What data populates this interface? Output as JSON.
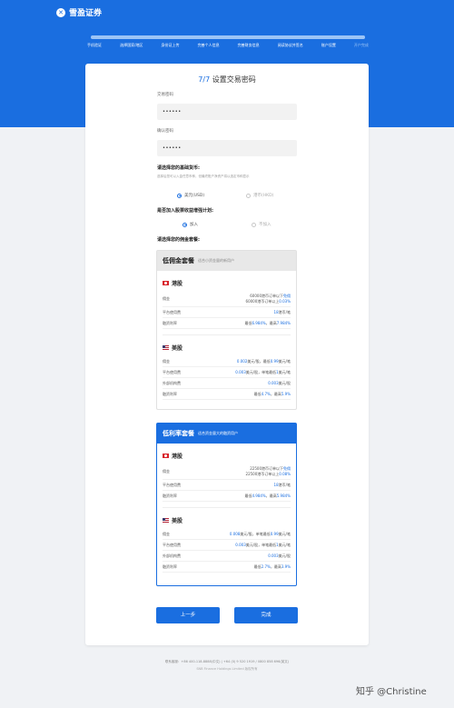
{
  "brand": {
    "logo_mark": "✕",
    "name": "雪盈证券"
  },
  "progress": {
    "fraction": 1.0
  },
  "steps": [
    "手机验证",
    "选择国家/地区",
    "身份证上传",
    "完善个人信息",
    "完善财务信息",
    "阅读协议并签名",
    "账户设置",
    "开户完成"
  ],
  "form": {
    "step_current": "7",
    "step_sep": "/",
    "step_total": "7",
    "title": "设置交易密码",
    "pwd_label": "交易密码",
    "pwd_value": "••••••",
    "confirm_label": "确认密码",
    "confirm_value": "••••••",
    "currency_q": "请选择您的基础货币:",
    "currency_hint": "选择后您可以入金任意币种，但最终账户净资产将以选定币种显示",
    "currency_opts": [
      "美元(USD)",
      "港币(HKD)"
    ],
    "margin_q": "是否加入股票收益增强计划:",
    "margin_opts": [
      "加入",
      "不加入"
    ],
    "pkg_q": "请选择您的佣金套餐:"
  },
  "packages": [
    {
      "name": "低佣金套餐",
      "sub": "适合小资金量的新用户",
      "markets": [
        {
          "name": "港股",
          "rows": [
            {
              "k": "佣金",
              "v1": "60000港币订单以下",
              "h1": "免佣",
              "v2": "60000港币订单以上",
              "h2": "0.03%"
            },
            {
              "k": "平台使用费",
              "h1": "18",
              "v1": "港币/笔"
            },
            {
              "k": "融资利率",
              "v1": "最低",
              "h1": "6.984%",
              "v2": "，最高",
              "h2": "7.984%"
            }
          ]
        },
        {
          "name": "美股",
          "rows": [
            {
              "k": "佣金",
              "h1": "0.002",
              "v1": "美元/股，最低",
              "h2": "0.99",
              "v2": "美元/笔"
            },
            {
              "k": "平台使用费",
              "h1": "0.003",
              "v1": "美元/股，单笔最低",
              "h2": "1",
              "v2": "美元/笔"
            },
            {
              "k": "外部机构费",
              "h1": "0.003",
              "v1": "美元/股"
            },
            {
              "k": "融资利率",
              "v1": "最低",
              "h1": "4.7%",
              "v2": "，最高",
              "h2": "5.9%"
            }
          ]
        }
      ]
    },
    {
      "name": "低利率套餐",
      "sub": "适合资金量大的融资用户",
      "markets": [
        {
          "name": "港股",
          "rows": [
            {
              "k": "佣金",
              "v1": "22500港币订单以下",
              "h1": "免佣",
              "v2": "22500港币订单以上",
              "h2": "0.08%"
            },
            {
              "k": "平台使用费",
              "h1": "18",
              "v1": "港币/笔"
            },
            {
              "k": "融资利率",
              "v1": "最低",
              "h1": "4.984%",
              "v2": "，最高",
              "h2": "5.984%"
            }
          ]
        },
        {
          "name": "美股",
          "rows": [
            {
              "k": "佣金",
              "h1": "0.008",
              "v1": "美元/股，单笔最低",
              "h2": "0.99",
              "v2": "美元/笔"
            },
            {
              "k": "平台使用费",
              "h1": "0.003",
              "v1": "美元/股，单笔最低",
              "h2": "1",
              "v2": "美元/笔"
            },
            {
              "k": "外部机构费",
              "h1": "0.003",
              "v1": "美元/股"
            },
            {
              "k": "融资利率",
              "v1": "最低",
              "h1": "2.7%",
              "v2": "，最高",
              "h2": "3.9%"
            }
          ]
        }
      ]
    }
  ],
  "buttons": {
    "prev": "上一步",
    "done": "完成"
  },
  "footer": {
    "line1": "联系客服：+86 400-118-8888(中文) | +64 (0) 9 520 1919 / 0800 858 696(英文)",
    "line2": "SNB Finance Holdings Limited 版权所有"
  },
  "watermark": "知乎 @Christine",
  "colors": {
    "brand_blue": "#1a6ee0",
    "page_bg": "#f0f2f5"
  }
}
